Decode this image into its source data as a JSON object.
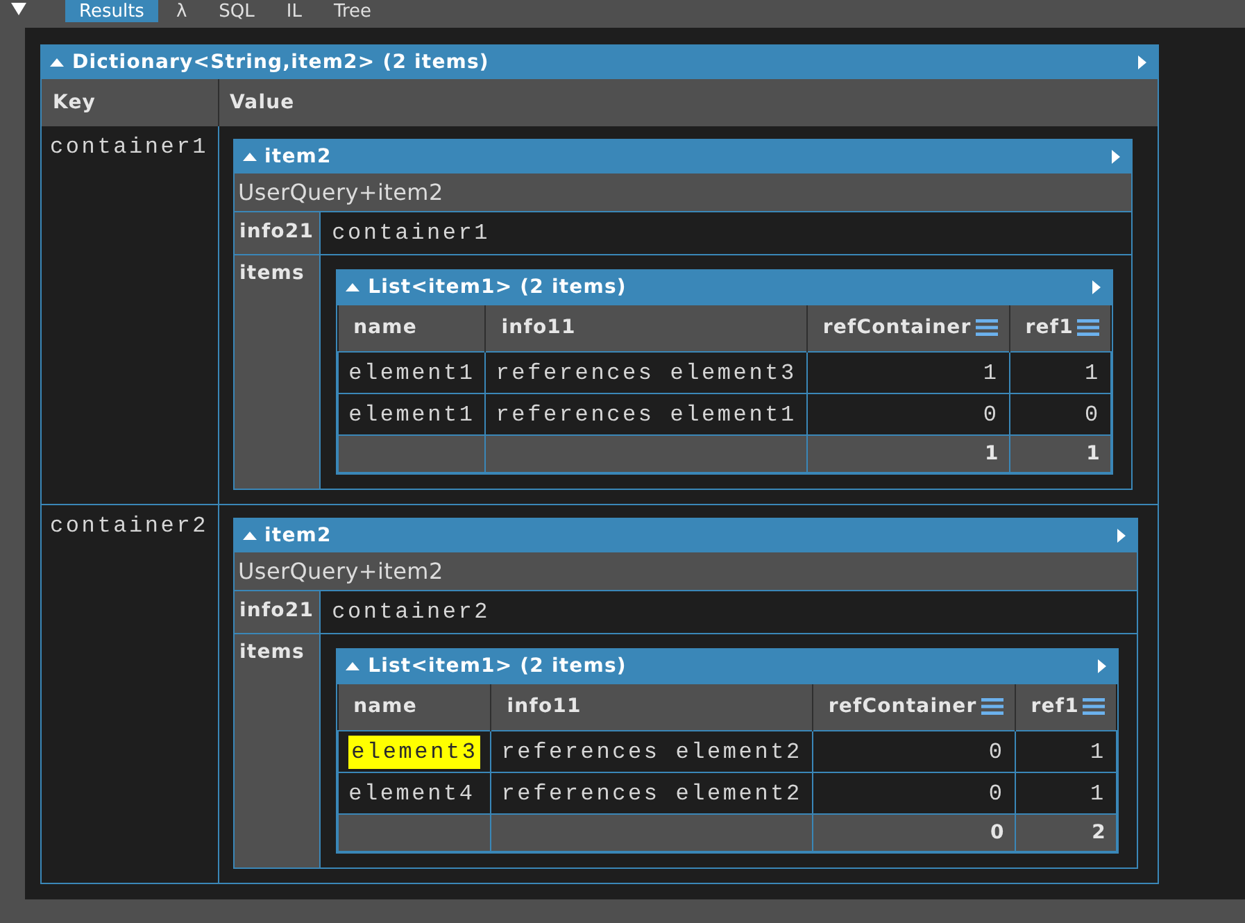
{
  "tab_bar": {
    "tabs": [
      {
        "label": "Results",
        "selected": true
      },
      {
        "label": "λ",
        "selected": false
      },
      {
        "label": "SQL",
        "selected": false
      },
      {
        "label": "IL",
        "selected": false
      },
      {
        "label": "Tree",
        "selected": false
      }
    ]
  },
  "dictionary": {
    "title": "Dictionary<String,item2> (2 items)",
    "expanded": true,
    "columns": [
      "Key",
      "Value"
    ],
    "rows": [
      {
        "key": "container1",
        "value": {
          "title": "item2",
          "expanded": true,
          "type_name": "UserQuery+item2",
          "fields": [
            {
              "label": "info21",
              "value": "container1"
            }
          ],
          "items_label": "items",
          "list": {
            "title": "List<item1> (2 items)",
            "expanded": true,
            "columns": [
              {
                "label": "name",
                "kind": "text"
              },
              {
                "label": "info11",
                "kind": "text"
              },
              {
                "label": "refContainer",
                "kind": "numeric"
              },
              {
                "label": "ref1",
                "kind": "numeric"
              }
            ],
            "rows": [
              {
                "cells": [
                  {
                    "text": "element1",
                    "highlighted": false
                  },
                  {
                    "text": "references element3",
                    "highlighted": false
                  },
                  {
                    "text": "1",
                    "highlighted": false
                  },
                  {
                    "text": "1",
                    "highlighted": false
                  }
                ]
              },
              {
                "cells": [
                  {
                    "text": "element1",
                    "highlighted": false
                  },
                  {
                    "text": "references element1",
                    "highlighted": false
                  },
                  {
                    "text": "0",
                    "highlighted": false
                  },
                  {
                    "text": "0",
                    "highlighted": false
                  }
                ]
              }
            ],
            "totals": [
              "1",
              "1"
            ]
          }
        }
      },
      {
        "key": "container2",
        "value": {
          "title": "item2",
          "expanded": true,
          "type_name": "UserQuery+item2",
          "fields": [
            {
              "label": "info21",
              "value": "container2"
            }
          ],
          "items_label": "items",
          "list": {
            "title": "List<item1> (2 items)",
            "expanded": true,
            "columns": [
              {
                "label": "name",
                "kind": "text"
              },
              {
                "label": "info11",
                "kind": "text"
              },
              {
                "label": "refContainer",
                "kind": "numeric"
              },
              {
                "label": "ref1",
                "kind": "numeric"
              }
            ],
            "rows": [
              {
                "cells": [
                  {
                    "text": "element3",
                    "highlighted": true
                  },
                  {
                    "text": "references element2",
                    "highlighted": false
                  },
                  {
                    "text": "0",
                    "highlighted": false
                  },
                  {
                    "text": "1",
                    "highlighted": false
                  }
                ]
              },
              {
                "cells": [
                  {
                    "text": "element4",
                    "highlighted": false
                  },
                  {
                    "text": "references element2",
                    "highlighted": false
                  },
                  {
                    "text": "0",
                    "highlighted": false
                  },
                  {
                    "text": "1",
                    "highlighted": false
                  }
                ]
              }
            ],
            "totals": [
              "0",
              "2"
            ]
          }
        }
      }
    ]
  }
}
